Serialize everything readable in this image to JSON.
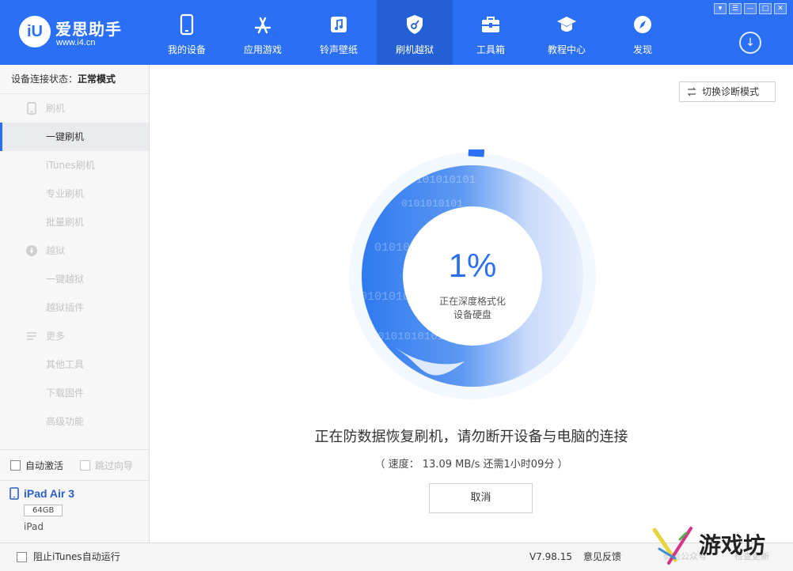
{
  "app": {
    "logo_mark": "iU",
    "name": "爱思助手",
    "url": "www.i4.cn"
  },
  "nav": [
    {
      "label": "我的设备",
      "icon": "phone-icon",
      "active": false
    },
    {
      "label": "应用游戏",
      "icon": "app-store-icon",
      "active": false
    },
    {
      "label": "铃声壁纸",
      "icon": "music-note-icon",
      "active": false
    },
    {
      "label": "刷机越狱",
      "icon": "shield-key-icon",
      "active": true
    },
    {
      "label": "工具箱",
      "icon": "toolbox-icon",
      "active": false
    },
    {
      "label": "教程中心",
      "icon": "graduation-cap-icon",
      "active": false
    },
    {
      "label": "发现",
      "icon": "compass-icon",
      "active": false
    }
  ],
  "window": {
    "controls": [
      "▾",
      "☰",
      "—",
      "□",
      "✕"
    ],
    "download_icon": "↓"
  },
  "sidebar": {
    "status_key": "设备连接状态：",
    "status_value": "正常模式",
    "groups": [
      {
        "label": "刷机",
        "icon": "phone-outline-icon",
        "items": [
          {
            "label": "一键刷机",
            "active": true
          },
          {
            "label": "iTunes刷机",
            "active": false
          },
          {
            "label": "专业刷机",
            "active": false
          },
          {
            "label": "批量刷机",
            "active": false
          }
        ]
      },
      {
        "label": "越狱",
        "icon": "jailbreak-icon",
        "items": [
          {
            "label": "一键越狱",
            "active": false
          },
          {
            "label": "越狱插件",
            "active": false
          }
        ]
      },
      {
        "label": "更多",
        "icon": "list-icon",
        "items": [
          {
            "label": "其他工具",
            "active": false
          },
          {
            "label": "下载固件",
            "active": false
          },
          {
            "label": "高级功能",
            "active": false
          }
        ]
      }
    ],
    "options": {
      "auto_activate": "自动激活",
      "skip_guide": "跳过向导"
    },
    "device": {
      "name": "iPad Air 3",
      "capacity": "64GB",
      "type": "iPad"
    }
  },
  "main": {
    "diag_button": "切换诊断模式",
    "progress": {
      "percent_value": 1,
      "percent_text": "1%",
      "sub_line1": "正在深度格式化",
      "sub_line2": "设备硬盘",
      "binary_text": "0101010101"
    },
    "status_main": "正在防数据恢复刷机，请勿断开设备与电脑的连接",
    "status_speed": "（ 速度： 13.09 MB/s  还需1小时09分 ）",
    "cancel_button": "取消"
  },
  "statusbar": {
    "block_itunes": "阻止iTunes自动运行",
    "version": "V7.98.15",
    "feedback": "意见反馈",
    "faint_1": "微信公众号",
    "faint_2": "检查更新"
  },
  "watermark": {
    "text": "游戏坊"
  },
  "colors": {
    "brand": "#2b6ff4",
    "brand_dark": "#2360d6",
    "progress_light": "#dde8fb"
  }
}
